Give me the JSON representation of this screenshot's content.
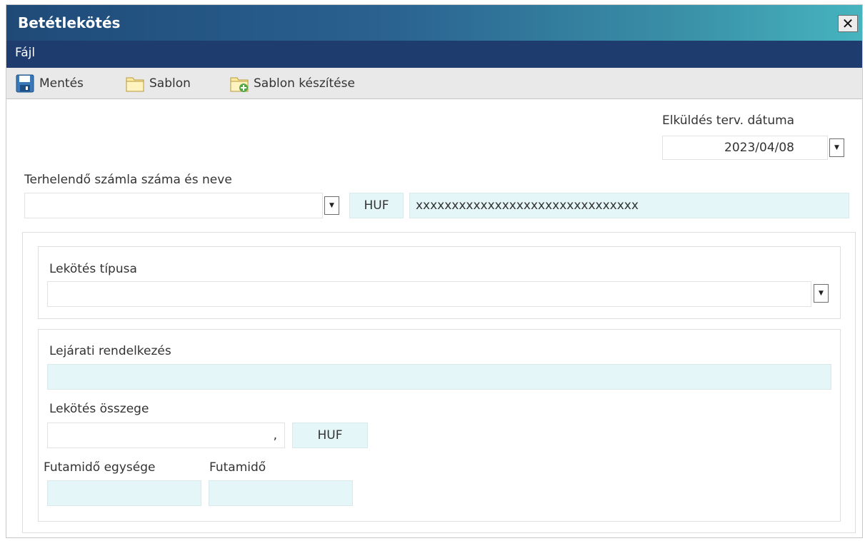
{
  "window": {
    "title": "Betétlekötés"
  },
  "menu": {
    "file_label": "Fájl"
  },
  "toolbar": {
    "save_label": "Mentés",
    "template_label": "Sablon",
    "create_template_label": "Sablon készítése"
  },
  "send_date": {
    "label": "Elküldés terv. dátuma",
    "value": "2023/04/08"
  },
  "debit_account": {
    "label": "Terhelendő számla száma és neve",
    "value": "",
    "currency": "HUF",
    "name": "xxxxxxxxxxxxxxxxxxxxxxxxxxxxxxx"
  },
  "deposit_type": {
    "label": "Lekötés típusa",
    "value": ""
  },
  "maturity": {
    "label": "Lejárati rendelkezés",
    "value": ""
  },
  "amount": {
    "label": "Lekötés összege",
    "decimal_sep": ",",
    "currency": "HUF"
  },
  "term_unit": {
    "label": "Futamidő egysége",
    "value": ""
  },
  "term": {
    "label": "Futamidő",
    "value": ""
  },
  "colors": {
    "title_start": "#1f4a78",
    "title_end": "#46b4bf",
    "menubar": "#1e3c6e",
    "readonly_bg": "#e5f6f8"
  }
}
